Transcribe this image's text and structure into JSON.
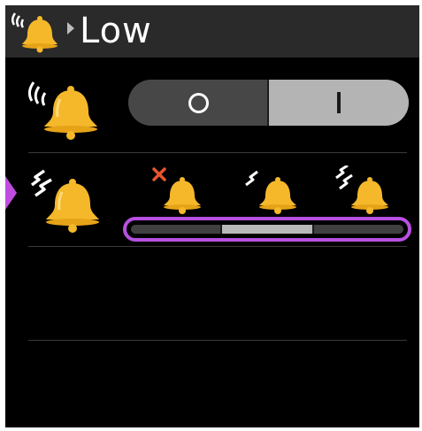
{
  "header": {
    "title": "Low",
    "icon": "ringing-bell-icon"
  },
  "mode_row": {
    "icon": "ringing-bell-icon",
    "toggle": {
      "state": "on",
      "off_symbol": "O",
      "on_symbol": "I"
    }
  },
  "level_row": {
    "icon": "vibrating-bell-icon",
    "options": [
      {
        "name": "off",
        "icon": "bell-off-icon"
      },
      {
        "name": "low",
        "icon": "bell-vibrate-low-icon"
      },
      {
        "name": "high",
        "icon": "bell-vibrate-high-icon"
      }
    ],
    "selected_index": 1
  },
  "colors": {
    "accent": "#b750e0",
    "bell": "#f5b82a",
    "off_mark": "#e8542e",
    "header_bg": "#2a2a2a",
    "toggle_on": "#b4b4b4"
  }
}
